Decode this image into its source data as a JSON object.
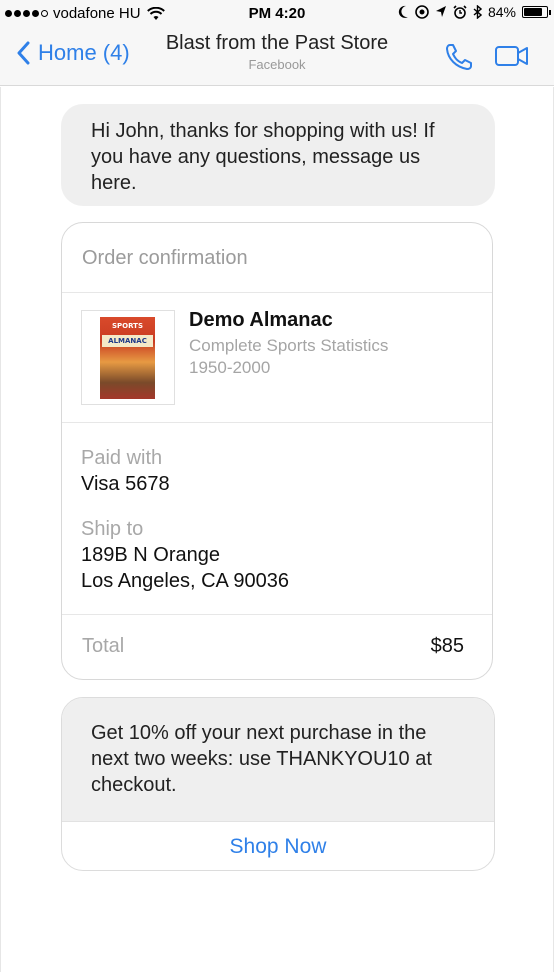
{
  "status_bar": {
    "carrier": "vodafone HU",
    "time": "PM 4:20",
    "battery_percent": "84%",
    "battery_level": 0.84
  },
  "nav": {
    "back_label": "Home (4)",
    "title": "Blast from the Past Store",
    "subtitle": "Facebook"
  },
  "messages": {
    "greeting": "Hi John, thanks for shopping with us! If you have any questions, message us here."
  },
  "receipt": {
    "header": "Order confirmation",
    "item": {
      "title": "Demo Almanac",
      "description": "Complete Sports Statistics 1950-2000",
      "thumb_top": "SPORTS",
      "thumb_band": "ALMANAC"
    },
    "paid_with_label": "Paid with",
    "paid_with_value": "Visa 5678",
    "ship_to_label": "Ship to",
    "ship_to_line1": "189B N Orange",
    "ship_to_line2": "Los Angeles, CA 90036",
    "total_label": "Total",
    "total_value": "$85"
  },
  "promo": {
    "text": "Get 10% off your next purchase in the next two weeks: use THANKYOU10 at checkout.",
    "button_label": "Shop Now"
  },
  "colors": {
    "accent": "#2f80e8",
    "bubble": "#efefef",
    "muted_text": "#a8a8a8"
  },
  "icons": [
    "wifi-icon",
    "moon-icon",
    "location-icon",
    "alarm-icon",
    "bluetooth-icon",
    "battery-icon",
    "back-chevron-icon",
    "phone-icon",
    "video-camera-icon"
  ]
}
